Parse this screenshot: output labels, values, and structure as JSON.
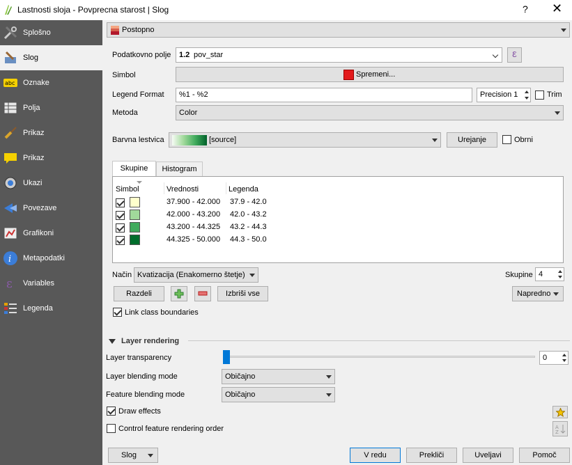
{
  "window": {
    "title": "Lastnosti sloja - Povprecna starost | Slog",
    "help": "?",
    "close": "✕"
  },
  "sidebar": {
    "items": [
      {
        "label": "Splošno",
        "icon": "wrench-icon"
      },
      {
        "label": "Slog",
        "icon": "paintbrush-icon"
      },
      {
        "label": "Oznake",
        "icon": "abc-label-icon"
      },
      {
        "label": "Polja",
        "icon": "table-icon"
      },
      {
        "label": "Prikaz",
        "icon": "brush-icon"
      },
      {
        "label": "Prikaz",
        "icon": "speech-bubble-icon"
      },
      {
        "label": "Ukazi",
        "icon": "gear-play-icon"
      },
      {
        "label": "Povezave",
        "icon": "join-icon"
      },
      {
        "label": "Grafikoni",
        "icon": "chart-icon"
      },
      {
        "label": "Metapodatki",
        "icon": "info-icon"
      },
      {
        "label": "Variables",
        "icon": "epsilon-icon"
      },
      {
        "label": "Legenda",
        "icon": "legend-icon"
      }
    ]
  },
  "renderer": {
    "value": "Postopno"
  },
  "form": {
    "column_label": "Podatkovno polje",
    "column_prefix": "1.2",
    "column_value": "pov_star",
    "expression_symbol": "ε",
    "symbol_label": "Simbol",
    "symbol_button": "Spremeni...",
    "legend_format_label": "Legend Format",
    "legend_format_value": "%1 - %2",
    "precision_label": "Precision 1",
    "trim_label": "Trim",
    "method_label": "Metoda",
    "method_value": "Color",
    "ramp_label": "Barvna lestvica",
    "ramp_value": "[source]",
    "edit_ramp": "Urejanje",
    "invert_label": "Obrni"
  },
  "tabs": [
    {
      "label": "Skupine"
    },
    {
      "label": "Histogram"
    }
  ],
  "table": {
    "headers": [
      "Simbol",
      "Vrednosti",
      "Legenda"
    ],
    "rows": [
      {
        "color": "#ffffcc",
        "value": "37.900 - 42.000",
        "legend": "37.9 - 42.0"
      },
      {
        "color": "#a1d99b",
        "value": "42.000 - 43.200",
        "legend": "42.0 - 43.2"
      },
      {
        "color": "#41ab5d",
        "value": "43.200 - 44.325",
        "legend": "43.2 - 44.3"
      },
      {
        "color": "#006d2c",
        "value": "44.325 - 50.000",
        "legend": "44.3 - 50.0"
      }
    ]
  },
  "classes": {
    "mode_label": "Način",
    "mode_value": "Kvatizacija (Enakomerno štetje)",
    "count_label": "Skupine",
    "count_value": "4",
    "classify": "Razdeli",
    "delete_all": "Izbriši vse",
    "advanced": "Napredno",
    "link_label": "Link class boundaries"
  },
  "layer_rendering": {
    "heading": "Layer rendering",
    "transparency_label": "Layer transparency",
    "transparency_value": "0",
    "transparency_level": 0,
    "layer_blend_label": "Layer blending mode",
    "layer_blend_value": "Običajno",
    "feature_blend_label": "Feature blending mode",
    "feature_blend_value": "Običajno",
    "draw_effects": "Draw effects",
    "control_order": "Control feature rendering order"
  },
  "footer": {
    "style_menu": "Slog",
    "ok": "V redu",
    "cancel": "Prekliči",
    "apply": "Uveljavi",
    "help": "Pomoč"
  },
  "colors": {
    "sidebar_bg": "#585858",
    "ramp_start": "#f7fcf5",
    "ramp_end": "#00612a",
    "symbol_red": "#e31a1c"
  }
}
